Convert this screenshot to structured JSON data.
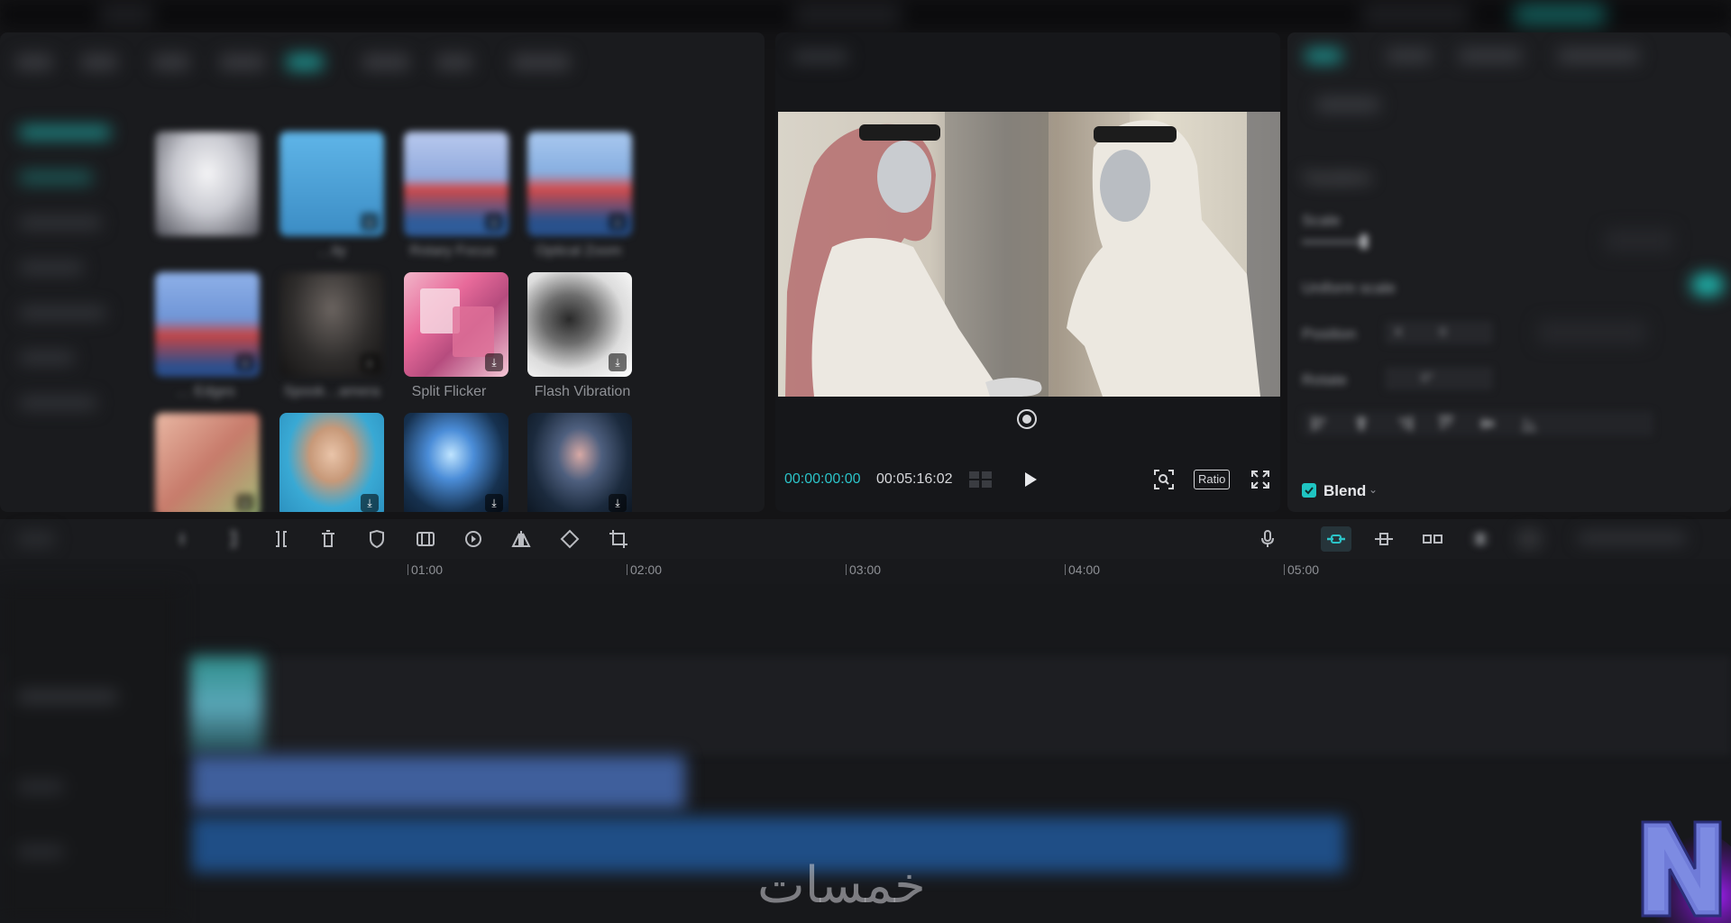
{
  "media": {
    "effects": [
      {
        "label": "",
        "shows_download": false
      },
      {
        "label": "…ity",
        "shows_download": true
      },
      {
        "label": "Rotary Focus",
        "shows_download": true
      },
      {
        "label": "Optical Zoom",
        "shows_download": true
      },
      {
        "label": "… Edges",
        "shows_download": true
      },
      {
        "label": "Spook…amera",
        "shows_download": true
      },
      {
        "label": "Split Flicker",
        "shows_download": true
      },
      {
        "label": "Flash Vibration",
        "shows_download": true
      },
      {
        "label": "",
        "shows_download": true
      },
      {
        "label": "",
        "shows_download": true
      },
      {
        "label": "",
        "shows_download": true
      },
      {
        "label": "",
        "shows_download": true
      }
    ]
  },
  "preview": {
    "time_current": "00:00:00:00",
    "time_total": "00:05:16:02",
    "ratio_label": "Ratio"
  },
  "inspector": {
    "section_title": "Transform",
    "scale_label": "Scale",
    "uniform_scale_label": "Uniform scale",
    "position_label": "Position",
    "position_x_prefix": "X",
    "position_x_value": "0",
    "rotate_label": "Rotate",
    "rotate_value": "0°",
    "blend_label": "Blend",
    "blend_checked": true
  },
  "timeline": {
    "ruler_ticks": [
      "01:00",
      "02:00",
      "03:00",
      "04:00",
      "05:00"
    ]
  },
  "watermark": {
    "text": "خمسات"
  },
  "colors": {
    "accent": "#2bc3c8",
    "panel": "#1b1c1f",
    "background": "#141416"
  }
}
